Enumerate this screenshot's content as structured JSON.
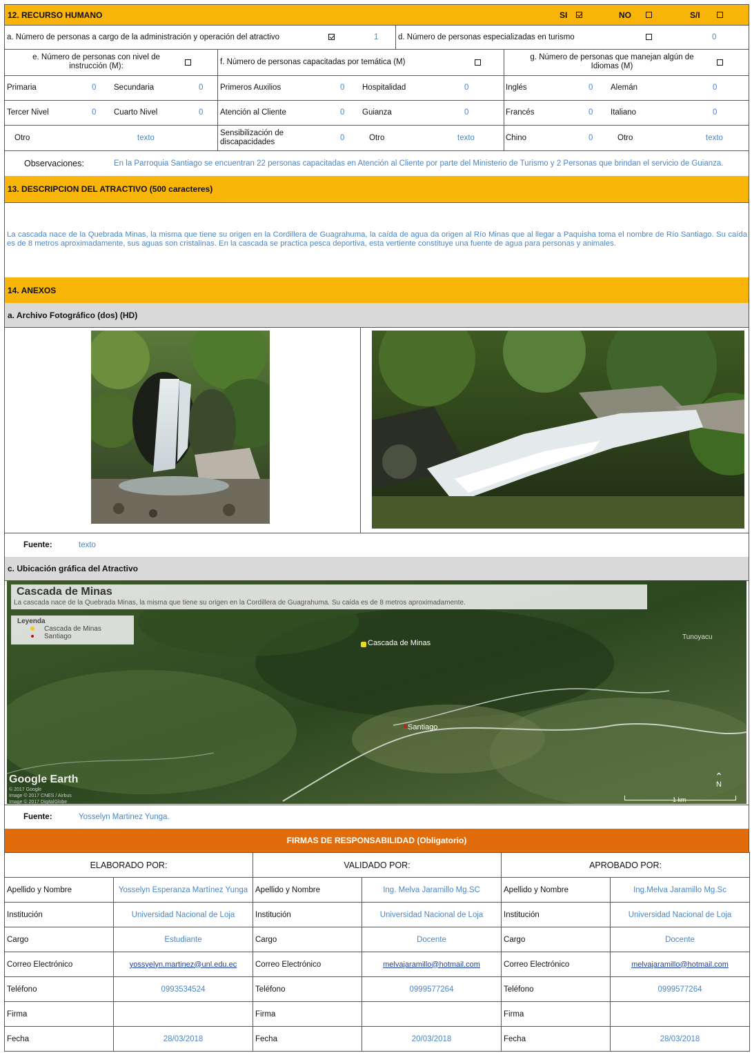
{
  "s12": {
    "title": "12. RECURSO HUMANO",
    "si": "SI",
    "no": "NO",
    "si_na": "S/I",
    "a_label": "a. Número de personas a cargo de la administración y operación del atractivo",
    "a_value": "1",
    "d_label": "d. Número de personas especializadas en turismo",
    "d_value": "0",
    "e_label": "e. Número de personas con nivel de instrucción (M):",
    "f_label": "f. Número de personas capacitadas por temática (M)",
    "g_label": "g. Número de personas que manejan algún de Idiomas (M)",
    "primaria": "Primaria",
    "primaria_v": "0",
    "secundaria": "Secundaria",
    "secundaria_v": "0",
    "tercer": "Tercer Nivel",
    "tercer_v": "0",
    "cuarto": "Cuarto Nivel",
    "cuarto_v": "0",
    "otro": "Otro",
    "otro_v": "texto",
    "primeros": "Primeros Auxilios",
    "primeros_v": "0",
    "hospitalidad": "Hospitalidad",
    "hospitalidad_v": "0",
    "atencion": "Atención al Cliente",
    "atencion_v": "0",
    "guianza": "Guianza",
    "guianza_v": "0",
    "sensib": "Sensibilización de discapacidades",
    "sensib_v": "0",
    "otro2": "Otro",
    "otro2_v": "texto",
    "ingles": "Inglés",
    "ingles_v": "0",
    "aleman": "Alemán",
    "aleman_v": "0",
    "frances": "Francés",
    "frances_v": "0",
    "italiano": "Italiano",
    "italiano_v": "0",
    "chino": "Chino",
    "chino_v": "0",
    "otro3": "Otro",
    "otro3_v": "texto",
    "obs_label": "Observaciones:",
    "obs_text": "En la Parroquia Santiago se encuentran 22 personas capacitadas en Atención al Cliente por parte del Ministerio de Turismo y 2 Personas que brindan el servicio de Guianza."
  },
  "s13": {
    "title": "13. DESCRIPCION DEL ATRACTIVO (500 caracteres)",
    "text": "La cascada nace de la Quebrada Minas, la misma que tiene su origen en la Cordillera de Guagrahuma, la caída de agua da origen al Río Minas que al llegar a Paquisha toma el nombre de Río Santiago. Su caída es de 8 metros aproximadamente, sus aguas son cristalinas. En la cascada se practica pesca deportiva, esta vertiente constituye una fuente de agua para personas y animales."
  },
  "s14": {
    "title": "14. ANEXOS",
    "photo_title": "a. Archivo Fotográfico (dos) (HD)",
    "fuente_label": "Fuente:",
    "fuente_value": "texto",
    "map_title": "c. Ubicación gráfica del Atractivo",
    "map_heading": "Cascada de Minas",
    "map_desc": "La cascada nace de la Quebrada Minas, la misma que tiene su origen en la Cordillera de Guagrahuma. Su caída es de 8 metros aproximadamente.",
    "legend_title": "Leyenda",
    "legend_1": "Cascada de Minas",
    "legend_2": "Santiago",
    "pin_cascada": "Cascada de Minas",
    "pin_santiago": "Santiago",
    "pin_other": "Tunoyacu",
    "google_earth": "Google Earth",
    "copyright_1": "© 2017 Google",
    "copyright_2": "Image © 2017 CNES / Airbus",
    "copyright_3": "Image © 2017 DigitalGlobe",
    "scale": "1 km",
    "north": "N",
    "fuente_map_label": "Fuente:",
    "fuente_map_value": "Yosselyn Martinez Yunga."
  },
  "firmas": {
    "title": "FIRMAS DE RESPONSABILIDAD (Obligatorio)",
    "cols": [
      "ELABORADO POR:",
      "VALIDADO POR:",
      "APROBADO POR:"
    ],
    "labels": [
      "Apellido y Nombre",
      "Institución",
      "Cargo",
      "Correo Electrónico",
      "Teléfono",
      "Firma",
      "Fecha"
    ],
    "elaborado": [
      "Yosselyn Esperanza Martínez Yunga",
      "Universidad Nacional de Loja",
      "Estudiante",
      "yossyelyn.martinez@unl.edu.ec",
      "0993534524",
      "",
      "28/03/2018"
    ],
    "validado": [
      "Ing. Melva Jaramillo Mg.SC",
      "Universidad Nacional de Loja",
      "Docente",
      "melvajaramillo@hotmail.com",
      "0999577264",
      "",
      "20/03/2018"
    ],
    "aprobado": [
      "Ing.Melva Jaramillo Mg.Sc",
      "Universidad Nacional de Loja",
      "Docente",
      "melvajaramillo@hotmail.com",
      "0999577264",
      "",
      "28/03/2018"
    ]
  },
  "colors": {
    "header": "#f9b40a",
    "firmas_header": "#e06c0c",
    "subheader": "#d9d9d9",
    "value": "#4a86c8"
  }
}
